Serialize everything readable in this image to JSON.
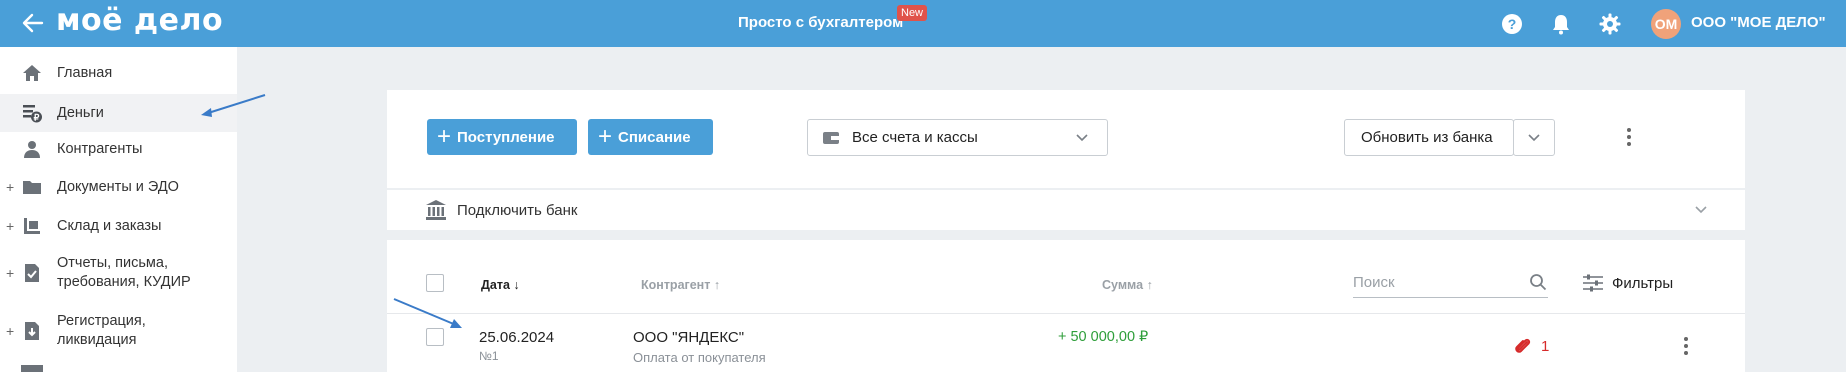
{
  "header": {
    "logo": "моё дело",
    "promo": "Просто с бухгалтером",
    "promo_badge": "New",
    "avatar_initials": "ОМ",
    "company_name": "ООО \"МОЕ ДЕЛО\"",
    "icons": [
      "back-arrow-icon",
      "help-icon",
      "bell-icon",
      "gear-icon"
    ]
  },
  "sidebar": {
    "items": [
      {
        "label": "Главная",
        "icon": "home-icon",
        "expandable": false
      },
      {
        "label": "Деньги",
        "icon": "money-icon",
        "expandable": false,
        "active": true
      },
      {
        "label": "Контрагенты",
        "icon": "contractors-icon",
        "expandable": false
      },
      {
        "label": "Документы и ЭДО",
        "icon": "folder-icon",
        "expandable": true
      },
      {
        "label": "Склад и заказы",
        "icon": "warehouse-icon",
        "expandable": true
      },
      {
        "label": "Отчеты, письма, требования, КУДИР",
        "icon": "report-icon",
        "expandable": true
      },
      {
        "label": "Регистрация, ликвидация",
        "icon": "registration-icon",
        "expandable": true
      }
    ]
  },
  "toolbar": {
    "income_button": "Поступление",
    "expense_button": "Списание",
    "accounts_select": "Все счета и кассы",
    "refresh_bank_button": "Обновить из банка"
  },
  "bank_panel": {
    "connect_label": "Подключить банк"
  },
  "table": {
    "columns": {
      "date": "Дата ↓",
      "contractor": "Контрагент ↑",
      "amount": "Сумма ↑"
    },
    "search_placeholder": "Поиск",
    "filters_label": "Фильтры",
    "rows": [
      {
        "date": "25.06.2024",
        "number": "№1",
        "contractor": "ООО \"ЯНДЕКС\"",
        "purpose": "Оплата от покупателя",
        "amount": "+ 50 000,00 ₽",
        "attachments": "1"
      }
    ]
  },
  "colors": {
    "accent": "#4a9fd8",
    "positive": "#2e9e3a",
    "attachment": "#d62b2b",
    "badge": "#e0534a",
    "annotation_arrow": "#3a7bc8"
  }
}
